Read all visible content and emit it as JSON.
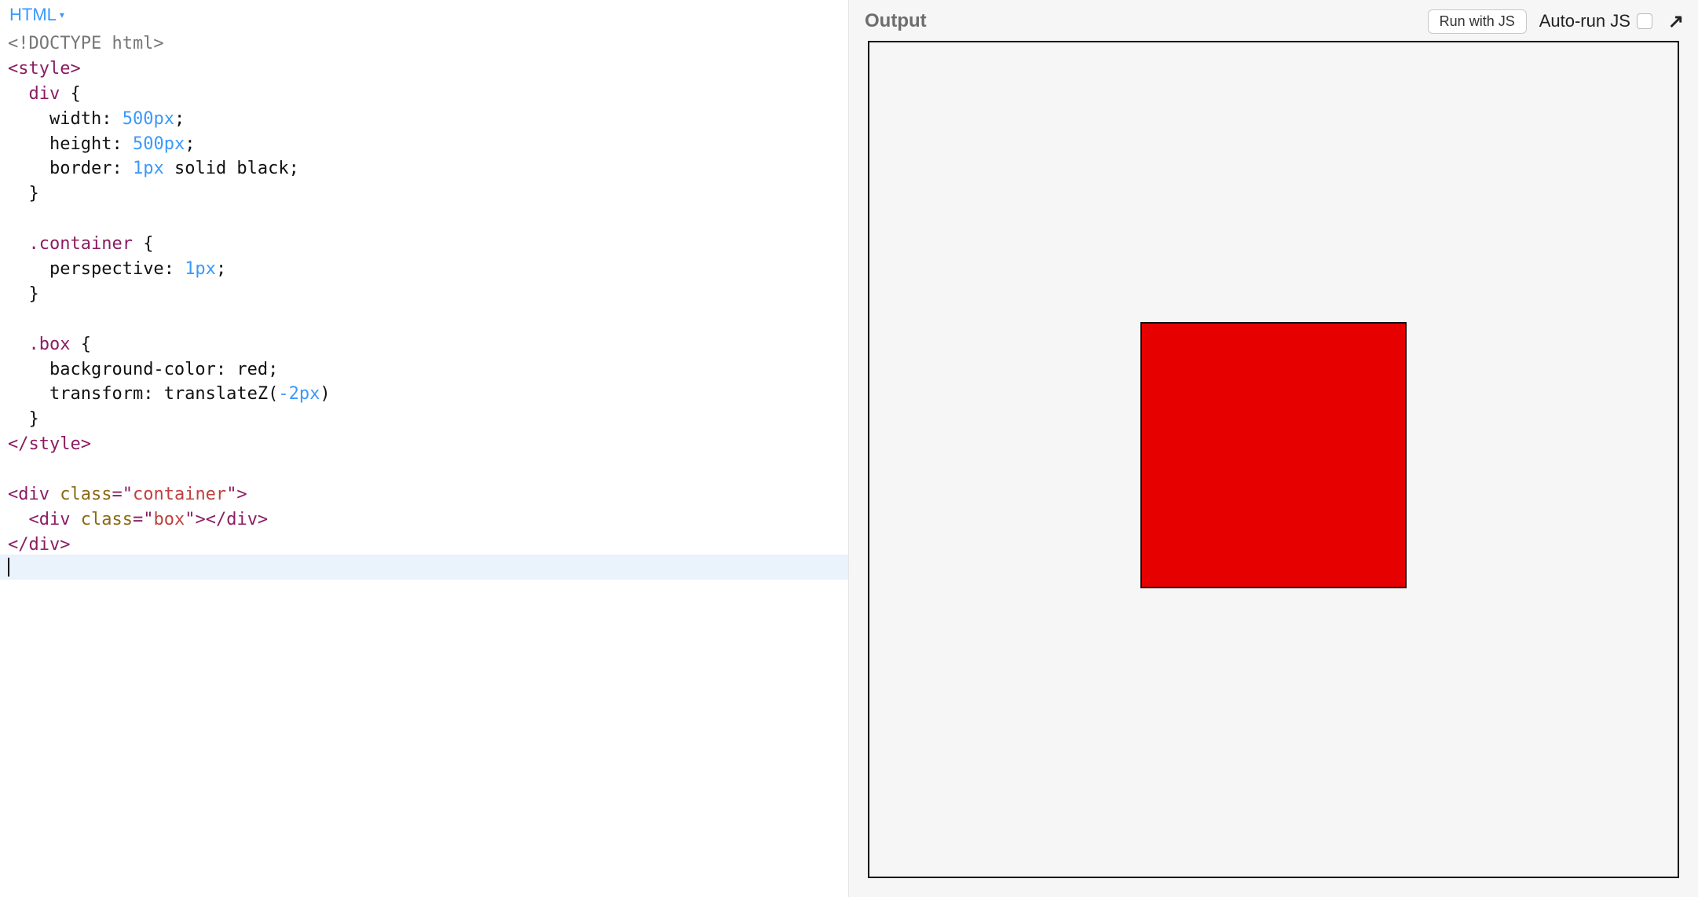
{
  "left": {
    "lang_label": "HTML",
    "code_lines": [
      {
        "segs": [
          {
            "t": "<!DOCTYPE html>",
            "c": "tok-doctype"
          }
        ]
      },
      {
        "segs": [
          {
            "t": "<style>",
            "c": "tok-tag"
          }
        ]
      },
      {
        "segs": [
          {
            "t": "  ",
            "c": "tok-plain"
          },
          {
            "t": "div",
            "c": "tok-sel"
          },
          {
            "t": " {",
            "c": "tok-plain"
          }
        ]
      },
      {
        "segs": [
          {
            "t": "    ",
            "c": "tok-plain"
          },
          {
            "t": "width",
            "c": "tok-prop"
          },
          {
            "t": ": ",
            "c": "tok-plain"
          },
          {
            "t": "500px",
            "c": "tok-num"
          },
          {
            "t": ";",
            "c": "tok-plain"
          }
        ]
      },
      {
        "segs": [
          {
            "t": "    ",
            "c": "tok-plain"
          },
          {
            "t": "height",
            "c": "tok-prop"
          },
          {
            "t": ": ",
            "c": "tok-plain"
          },
          {
            "t": "500px",
            "c": "tok-num"
          },
          {
            "t": ";",
            "c": "tok-plain"
          }
        ]
      },
      {
        "segs": [
          {
            "t": "    ",
            "c": "tok-plain"
          },
          {
            "t": "border",
            "c": "tok-prop"
          },
          {
            "t": ": ",
            "c": "tok-plain"
          },
          {
            "t": "1px",
            "c": "tok-num"
          },
          {
            "t": " solid black;",
            "c": "tok-plain"
          }
        ]
      },
      {
        "segs": [
          {
            "t": "  }",
            "c": "tok-plain"
          }
        ]
      },
      {
        "segs": [
          {
            "t": "",
            "c": "tok-plain"
          }
        ]
      },
      {
        "segs": [
          {
            "t": "  ",
            "c": "tok-plain"
          },
          {
            "t": ".container",
            "c": "tok-sel"
          },
          {
            "t": " {",
            "c": "tok-plain"
          }
        ]
      },
      {
        "segs": [
          {
            "t": "    ",
            "c": "tok-plain"
          },
          {
            "t": "perspective",
            "c": "tok-prop"
          },
          {
            "t": ": ",
            "c": "tok-plain"
          },
          {
            "t": "1px",
            "c": "tok-num"
          },
          {
            "t": ";",
            "c": "tok-plain"
          }
        ]
      },
      {
        "segs": [
          {
            "t": "  }",
            "c": "tok-plain"
          }
        ]
      },
      {
        "segs": [
          {
            "t": "",
            "c": "tok-plain"
          }
        ]
      },
      {
        "segs": [
          {
            "t": "  ",
            "c": "tok-plain"
          },
          {
            "t": ".box",
            "c": "tok-sel"
          },
          {
            "t": " {",
            "c": "tok-plain"
          }
        ]
      },
      {
        "segs": [
          {
            "t": "    ",
            "c": "tok-plain"
          },
          {
            "t": "background-color",
            "c": "tok-prop"
          },
          {
            "t": ": red;",
            "c": "tok-plain"
          }
        ]
      },
      {
        "segs": [
          {
            "t": "    ",
            "c": "tok-plain"
          },
          {
            "t": "transform",
            "c": "tok-prop"
          },
          {
            "t": ": translateZ(",
            "c": "tok-plain"
          },
          {
            "t": "-2px",
            "c": "tok-num"
          },
          {
            "t": ")",
            "c": "tok-plain"
          }
        ]
      },
      {
        "segs": [
          {
            "t": "  }",
            "c": "tok-plain"
          }
        ]
      },
      {
        "segs": [
          {
            "t": "</style>",
            "c": "tok-tag"
          }
        ]
      },
      {
        "segs": [
          {
            "t": "",
            "c": "tok-plain"
          }
        ]
      },
      {
        "segs": [
          {
            "t": "<div ",
            "c": "tok-tag"
          },
          {
            "t": "class",
            "c": "tok-attr"
          },
          {
            "t": "=\"",
            "c": "tok-tag"
          },
          {
            "t": "container",
            "c": "tok-str"
          },
          {
            "t": "\">",
            "c": "tok-tag"
          }
        ]
      },
      {
        "segs": [
          {
            "t": "  ",
            "c": "tok-plain"
          },
          {
            "t": "<div ",
            "c": "tok-tag"
          },
          {
            "t": "class",
            "c": "tok-attr"
          },
          {
            "t": "=\"",
            "c": "tok-tag"
          },
          {
            "t": "box",
            "c": "tok-str"
          },
          {
            "t": "\"></div>",
            "c": "tok-tag"
          }
        ]
      },
      {
        "segs": [
          {
            "t": "</div>",
            "c": "tok-tag"
          }
        ]
      }
    ],
    "cursor_line_index": 21
  },
  "right": {
    "title": "Output",
    "run_label": "Run with JS",
    "autorun_label": "Auto-run JS",
    "autorun_checked": false,
    "popout_glyph": "↗"
  },
  "preview": {
    "container_border_color": "#111",
    "container_bg": "#f6f6f6",
    "box_color": "#e60000"
  }
}
